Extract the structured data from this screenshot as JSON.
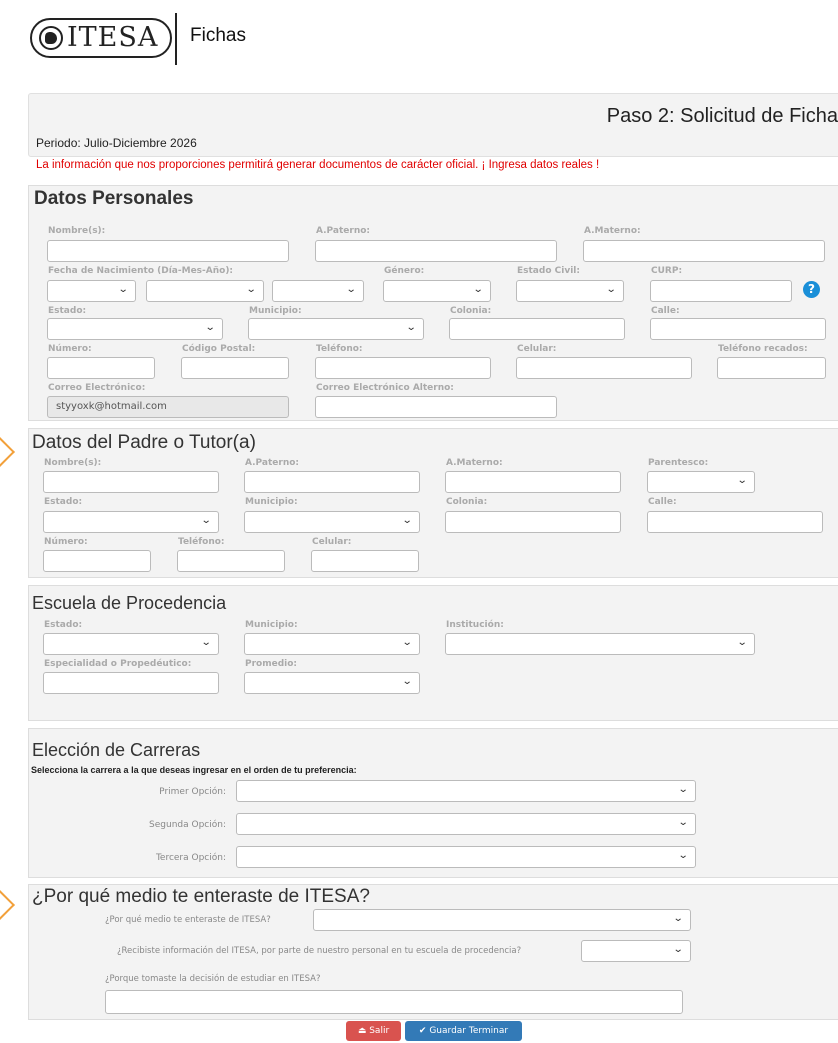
{
  "header": {
    "logo_text": "ITESA",
    "app_title": "Fichas"
  },
  "step": {
    "title": "Paso 2: Solicitud de Ficha",
    "periodo": "Periodo: Julio-Diciembre 2026",
    "aviso": "La información que nos proporciones permitirá generar documentos de carácter oficial. ¡ Ingresa datos reales !"
  },
  "personal": {
    "title": "Datos Personales",
    "labels": {
      "nombre": "Nombre(s):",
      "paterno": "A.Paterno:",
      "materno": "A.Materno:",
      "fecha": "Fecha de Nacimiento (Día-Mes-Año):",
      "genero": "Género:",
      "civil": "Estado Civil:",
      "curp": "CURP:",
      "estado": "Estado:",
      "municipio": "Municipio:",
      "colonia": "Colonia:",
      "calle": "Calle:",
      "numero": "Número:",
      "cp": "Código Postal:",
      "telefono": "Teléfono:",
      "celular": "Celular:",
      "recados": "Teléfono recados:",
      "correo": "Correo Electrónico:",
      "correo_alt": "Correo Electrónico Alterno:"
    },
    "email_value": "styyoxk@hotmail.com",
    "help_glyph": "?"
  },
  "tutor": {
    "title": "Datos del Padre o Tutor(a)",
    "labels": {
      "nombre": "Nombre(s):",
      "paterno": "A.Paterno:",
      "materno": "A.Materno:",
      "parentesco": "Parentesco:",
      "estado": "Estado:",
      "municipio": "Municipio:",
      "colonia": "Colonia:",
      "calle": "Calle:",
      "numero": "Número:",
      "telefono": "Teléfono:",
      "celular": "Celular:"
    }
  },
  "escuela": {
    "title": "Escuela de Procedencia",
    "labels": {
      "estado": "Estado:",
      "municipio": "Municipio:",
      "institucion": "Institución:",
      "especialidad": "Especialidad o Propedéutico:",
      "promedio": "Promedio:"
    }
  },
  "carreras": {
    "title": "Elección de Carreras",
    "subtitle": "Selecciona la carrera a la que deseas ingresar en el orden de tu preferencia:",
    "opciones": [
      "Primer Opción:",
      "Segunda Opción:",
      "Tercera Opción:"
    ]
  },
  "medio": {
    "title": "¿Por qué medio te enteraste de ITESA?",
    "q1": "¿Por qué medio te enteraste de ITESA?",
    "q2": "¿Recibiste información del ITESA, por parte de nuestro personal en tu escuela de procedencia?",
    "q3": "¿Porque tomaste la decisión de estudiar en ITESA?"
  },
  "buttons": {
    "salir": "Salir",
    "guardar": "Guardar Terminar",
    "salir_color": "#d9534f",
    "guardar_color": "#337ab7"
  },
  "icons": {
    "chevron": "chevron-down-icon",
    "salir_icon": "eject-icon",
    "guardar_icon": "check-icon"
  },
  "colors": {
    "required_red": "#e00000",
    "help_blue": "#1a8fd8",
    "annotation_orange": "#f2a03a"
  }
}
